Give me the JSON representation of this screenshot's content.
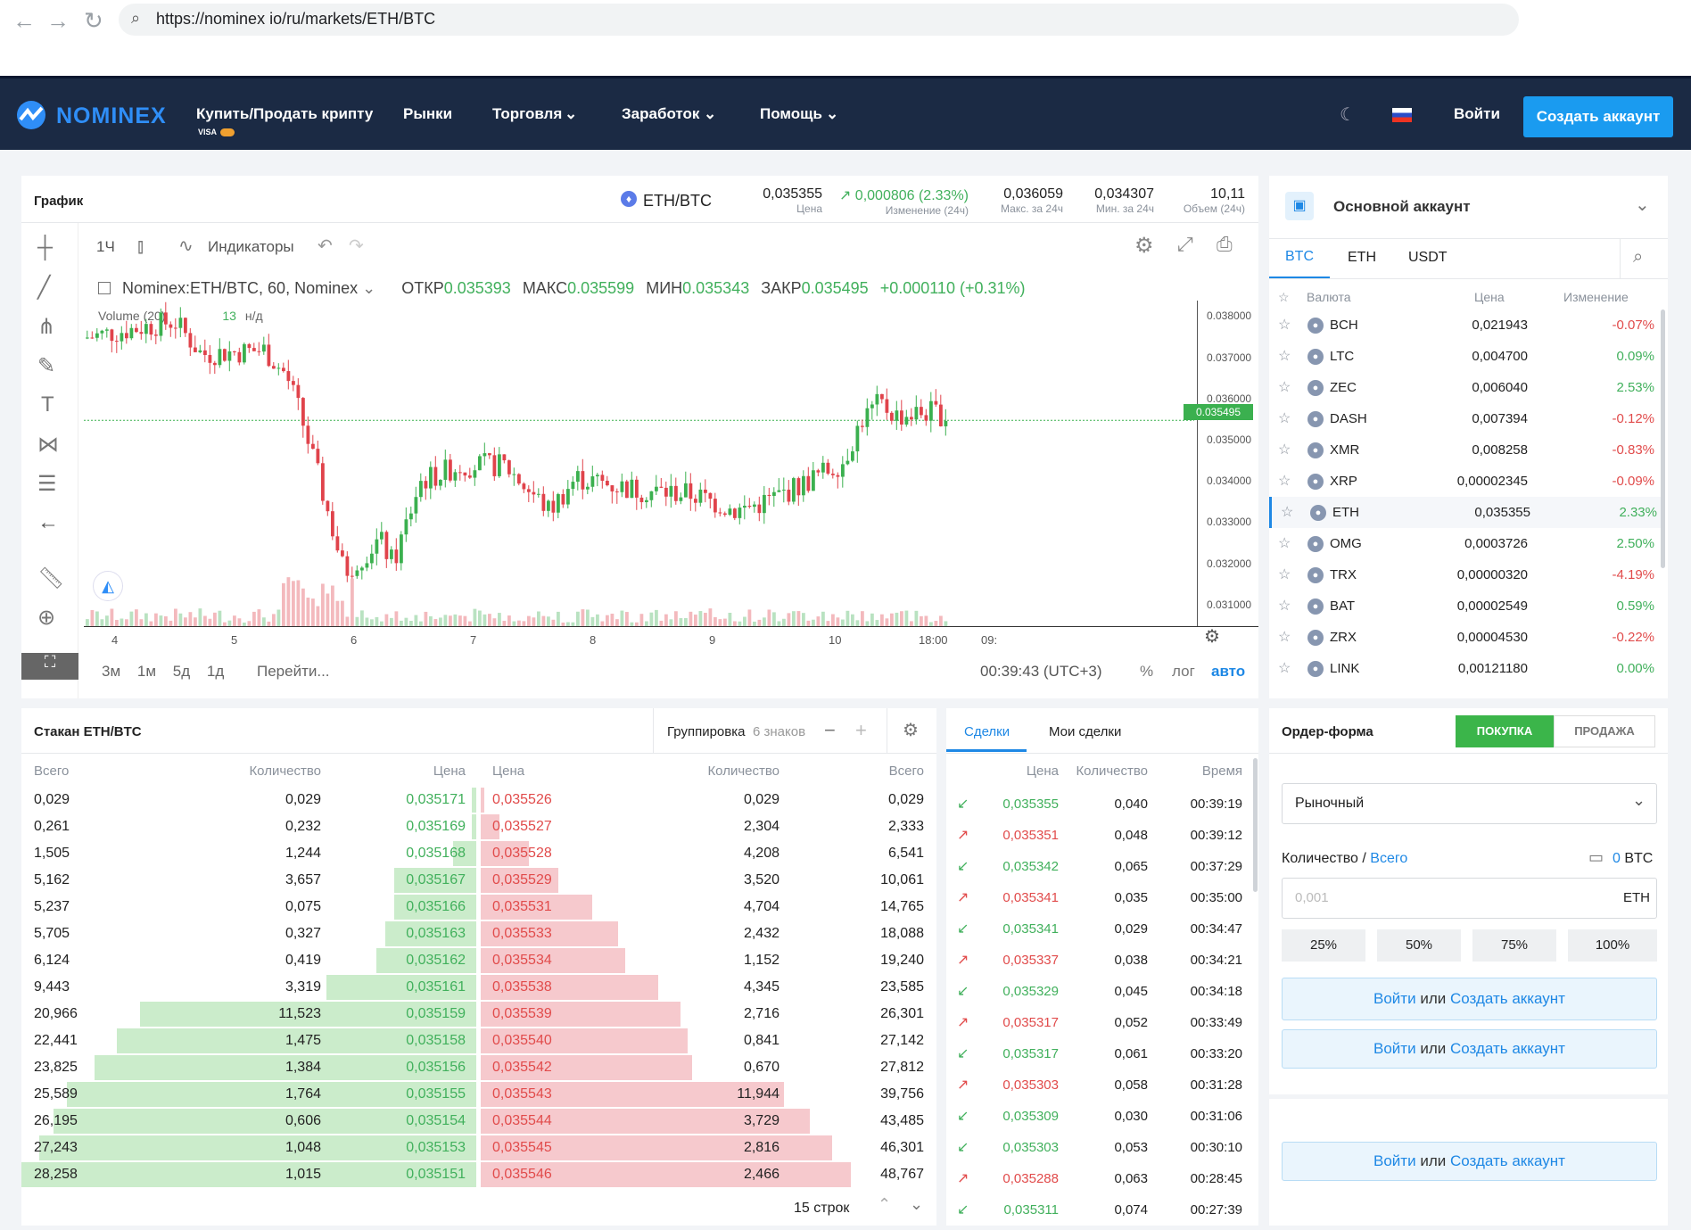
{
  "browser": {
    "url": "https://nominex io/ru/markets/ETH/BTC"
  },
  "header": {
    "logo": "NOMINEX",
    "nav": [
      {
        "label": "Купить/Продать крипту",
        "sub": "VISA"
      },
      {
        "label": "Рынки"
      },
      {
        "label": "Торговля"
      },
      {
        "label": "Заработок"
      },
      {
        "label": "Помощь"
      }
    ],
    "login": "Войти",
    "create_account": "Создать аккаунт"
  },
  "chart_panel": {
    "title": "График",
    "pair": "ETH/BTC",
    "stats": [
      {
        "value": "0,035355",
        "label": "Цена"
      },
      {
        "value": "0,000806 (2.33%)",
        "label": "Изменение (24ч)"
      },
      {
        "value": "0,036059",
        "label": "Макс. за 24ч"
      },
      {
        "value": "0,034307",
        "label": "Мин. за 24ч"
      },
      {
        "value": "10,11",
        "label": "Объем (24ч)"
      }
    ],
    "toolbar": {
      "interval": "1Ч",
      "indicators": "Индикаторы"
    },
    "legend": {
      "symbol": "Nominex:ETH/BTC, 60, Nominex",
      "open_label": "ОТКР",
      "open": "0.035393",
      "high_label": "МАКС",
      "high": "0.035599",
      "low_label": "МИН",
      "low": "0.035343",
      "close_label": "ЗАКР",
      "close": "0.035495",
      "change": "+0.000110 (+0.31%)"
    },
    "volume_label": "Volume (20)",
    "volume_value": "13",
    "volume_na": "н/д",
    "last_price_tag": "0.035495",
    "y_ticks": [
      "0.038000",
      "0.037000",
      "0.036000",
      "0.035000",
      "0.034000",
      "0.033000",
      "0.032000",
      "0.031000"
    ],
    "x_ticks": [
      "4",
      "5",
      "6",
      "7",
      "8",
      "9",
      "10",
      "18:00",
      "09:"
    ],
    "ranges": [
      "3м",
      "1м",
      "5д",
      "1д"
    ],
    "goto": "Перейти...",
    "time": "00:39:43 (UTC+3)",
    "scale": [
      "%",
      "лог",
      "авто"
    ]
  },
  "account": {
    "title": "Основной аккаунт",
    "tabs": [
      "BTC",
      "ETH",
      "USDT"
    ],
    "headers": [
      "Валюта",
      "Цена",
      "Изменение"
    ],
    "rows": [
      {
        "sym": "BCH",
        "price": "0,021943",
        "chg": "-0.07%",
        "up": false
      },
      {
        "sym": "LTC",
        "price": "0,004700",
        "chg": "0.09%",
        "up": true
      },
      {
        "sym": "ZEC",
        "price": "0,006040",
        "chg": "2.53%",
        "up": true
      },
      {
        "sym": "DASH",
        "price": "0,007394",
        "chg": "-0.12%",
        "up": false
      },
      {
        "sym": "XMR",
        "price": "0,008258",
        "chg": "-0.83%",
        "up": false
      },
      {
        "sym": "XRP",
        "price": "0,00002345",
        "chg": "-0.09%",
        "up": false
      },
      {
        "sym": "ETH",
        "price": "0,035355",
        "chg": "2.33%",
        "up": true
      },
      {
        "sym": "OMG",
        "price": "0,0003726",
        "chg": "2.50%",
        "up": true
      },
      {
        "sym": "TRX",
        "price": "0,00000320",
        "chg": "-4.19%",
        "up": false
      },
      {
        "sym": "BAT",
        "price": "0,00002549",
        "chg": "0.59%",
        "up": true
      },
      {
        "sym": "ZRX",
        "price": "0,00004530",
        "chg": "-0.22%",
        "up": false
      },
      {
        "sym": "LINK",
        "price": "0,00121180",
        "chg": "0.00%",
        "up": true
      }
    ]
  },
  "orderbook": {
    "title": "Стакан ETH/BTC",
    "grouping": "Группировка",
    "grouping_value": "6 знаков",
    "headers": [
      "Всего",
      "Количество",
      "Цена",
      "Цена",
      "Количество",
      "Всего"
    ],
    "bids": [
      {
        "total": "0,029",
        "qty": "0,029",
        "price": "0,035171",
        "depth": 0.01
      },
      {
        "total": "0,261",
        "qty": "0,232",
        "price": "0,035169",
        "depth": 0.01
      },
      {
        "total": "1,505",
        "qty": "1,244",
        "price": "0,035168",
        "depth": 0.05
      },
      {
        "total": "5,162",
        "qty": "3,657",
        "price": "0,035167",
        "depth": 0.18
      },
      {
        "total": "5,237",
        "qty": "0,075",
        "price": "0,035166",
        "depth": 0.18
      },
      {
        "total": "5,705",
        "qty": "0,327",
        "price": "0,035163",
        "depth": 0.2
      },
      {
        "total": "6,124",
        "qty": "0,419",
        "price": "0,035162",
        "depth": 0.22
      },
      {
        "total": "9,443",
        "qty": "3,319",
        "price": "0,035161",
        "depth": 0.33
      },
      {
        "total": "20,966",
        "qty": "11,523",
        "price": "0,035159",
        "depth": 0.74
      },
      {
        "total": "22,441",
        "qty": "1,475",
        "price": "0,035158",
        "depth": 0.79
      },
      {
        "total": "23,825",
        "qty": "1,384",
        "price": "0,035156",
        "depth": 0.84
      },
      {
        "total": "25,589",
        "qty": "1,764",
        "price": "0,035155",
        "depth": 0.9
      },
      {
        "total": "26,195",
        "qty": "0,606",
        "price": "0,035154",
        "depth": 0.93
      },
      {
        "total": "27,243",
        "qty": "1,048",
        "price": "0,035153",
        "depth": 0.96
      },
      {
        "total": "28,258",
        "qty": "1,015",
        "price": "0,035151",
        "depth": 1.0
      }
    ],
    "asks": [
      {
        "price": "0,035526",
        "qty": "0,029",
        "total": "0,029",
        "depth": 0.01
      },
      {
        "price": "0,035527",
        "qty": "2,304",
        "total": "2,333",
        "depth": 0.05
      },
      {
        "price": "0,035528",
        "qty": "4,208",
        "total": "6,541",
        "depth": 0.13
      },
      {
        "price": "0,035529",
        "qty": "3,520",
        "total": "10,061",
        "depth": 0.21
      },
      {
        "price": "0,035531",
        "qty": "4,704",
        "total": "14,765",
        "depth": 0.3
      },
      {
        "price": "0,035533",
        "qty": "2,432",
        "total": "18,088",
        "depth": 0.37
      },
      {
        "price": "0,035534",
        "qty": "1,152",
        "total": "19,240",
        "depth": 0.39
      },
      {
        "price": "0,035538",
        "qty": "4,345",
        "total": "23,585",
        "depth": 0.48
      },
      {
        "price": "0,035539",
        "qty": "2,716",
        "total": "26,301",
        "depth": 0.54
      },
      {
        "price": "0,035540",
        "qty": "0,841",
        "total": "27,142",
        "depth": 0.56
      },
      {
        "price": "0,035542",
        "qty": "0,670",
        "total": "27,812",
        "depth": 0.57
      },
      {
        "price": "0,035543",
        "qty": "11,944",
        "total": "39,756",
        "depth": 0.82
      },
      {
        "price": "0,035544",
        "qty": "3,729",
        "total": "43,485",
        "depth": 0.89
      },
      {
        "price": "0,035545",
        "qty": "2,816",
        "total": "46,301",
        "depth": 0.95
      },
      {
        "price": "0,035546",
        "qty": "2,466",
        "total": "48,767",
        "depth": 1.0
      }
    ],
    "rows_label": "15 строк"
  },
  "trades": {
    "tabs": [
      "Сделки",
      "Мои сделки"
    ],
    "headers": [
      "Цена",
      "Количество",
      "Время"
    ],
    "rows": [
      {
        "price": "0,035355",
        "qty": "0,040",
        "time": "00:39:19",
        "side": "buy"
      },
      {
        "price": "0,035351",
        "qty": "0,048",
        "time": "00:39:12",
        "side": "sell"
      },
      {
        "price": "0,035342",
        "qty": "0,065",
        "time": "00:37:29",
        "side": "buy"
      },
      {
        "price": "0,035341",
        "qty": "0,035",
        "time": "00:35:00",
        "side": "sell"
      },
      {
        "price": "0,035341",
        "qty": "0,029",
        "time": "00:34:47",
        "side": "buy"
      },
      {
        "price": "0,035337",
        "qty": "0,038",
        "time": "00:34:21",
        "side": "sell"
      },
      {
        "price": "0,035329",
        "qty": "0,045",
        "time": "00:34:18",
        "side": "buy"
      },
      {
        "price": "0,035317",
        "qty": "0,052",
        "time": "00:33:49",
        "side": "sell"
      },
      {
        "price": "0,035317",
        "qty": "0,061",
        "time": "00:33:20",
        "side": "buy"
      },
      {
        "price": "0,035303",
        "qty": "0,058",
        "time": "00:31:28",
        "side": "sell"
      },
      {
        "price": "0,035309",
        "qty": "0,030",
        "time": "00:31:06",
        "side": "buy"
      },
      {
        "price": "0,035303",
        "qty": "0,053",
        "time": "00:30:10",
        "side": "buy"
      },
      {
        "price": "0,035288",
        "qty": "0,063",
        "time": "00:28:45",
        "side": "sell"
      },
      {
        "price": "0,035311",
        "qty": "0,074",
        "time": "00:27:39",
        "side": "buy"
      }
    ]
  },
  "order_form": {
    "title": "Ордер-форма",
    "buy": "ПОКУПКА",
    "sell": "ПРОДАЖА",
    "type": "Рыночный",
    "qty_label": "Количество",
    "total_label": "Всего",
    "balance": "0 BTC",
    "qty_placeholder": "0,001",
    "qty_unit": "ETH",
    "percents": [
      "25%",
      "50%",
      "75%",
      "100%"
    ],
    "login": "Войти",
    "or": "или",
    "create": "Создать аккаунт"
  }
}
